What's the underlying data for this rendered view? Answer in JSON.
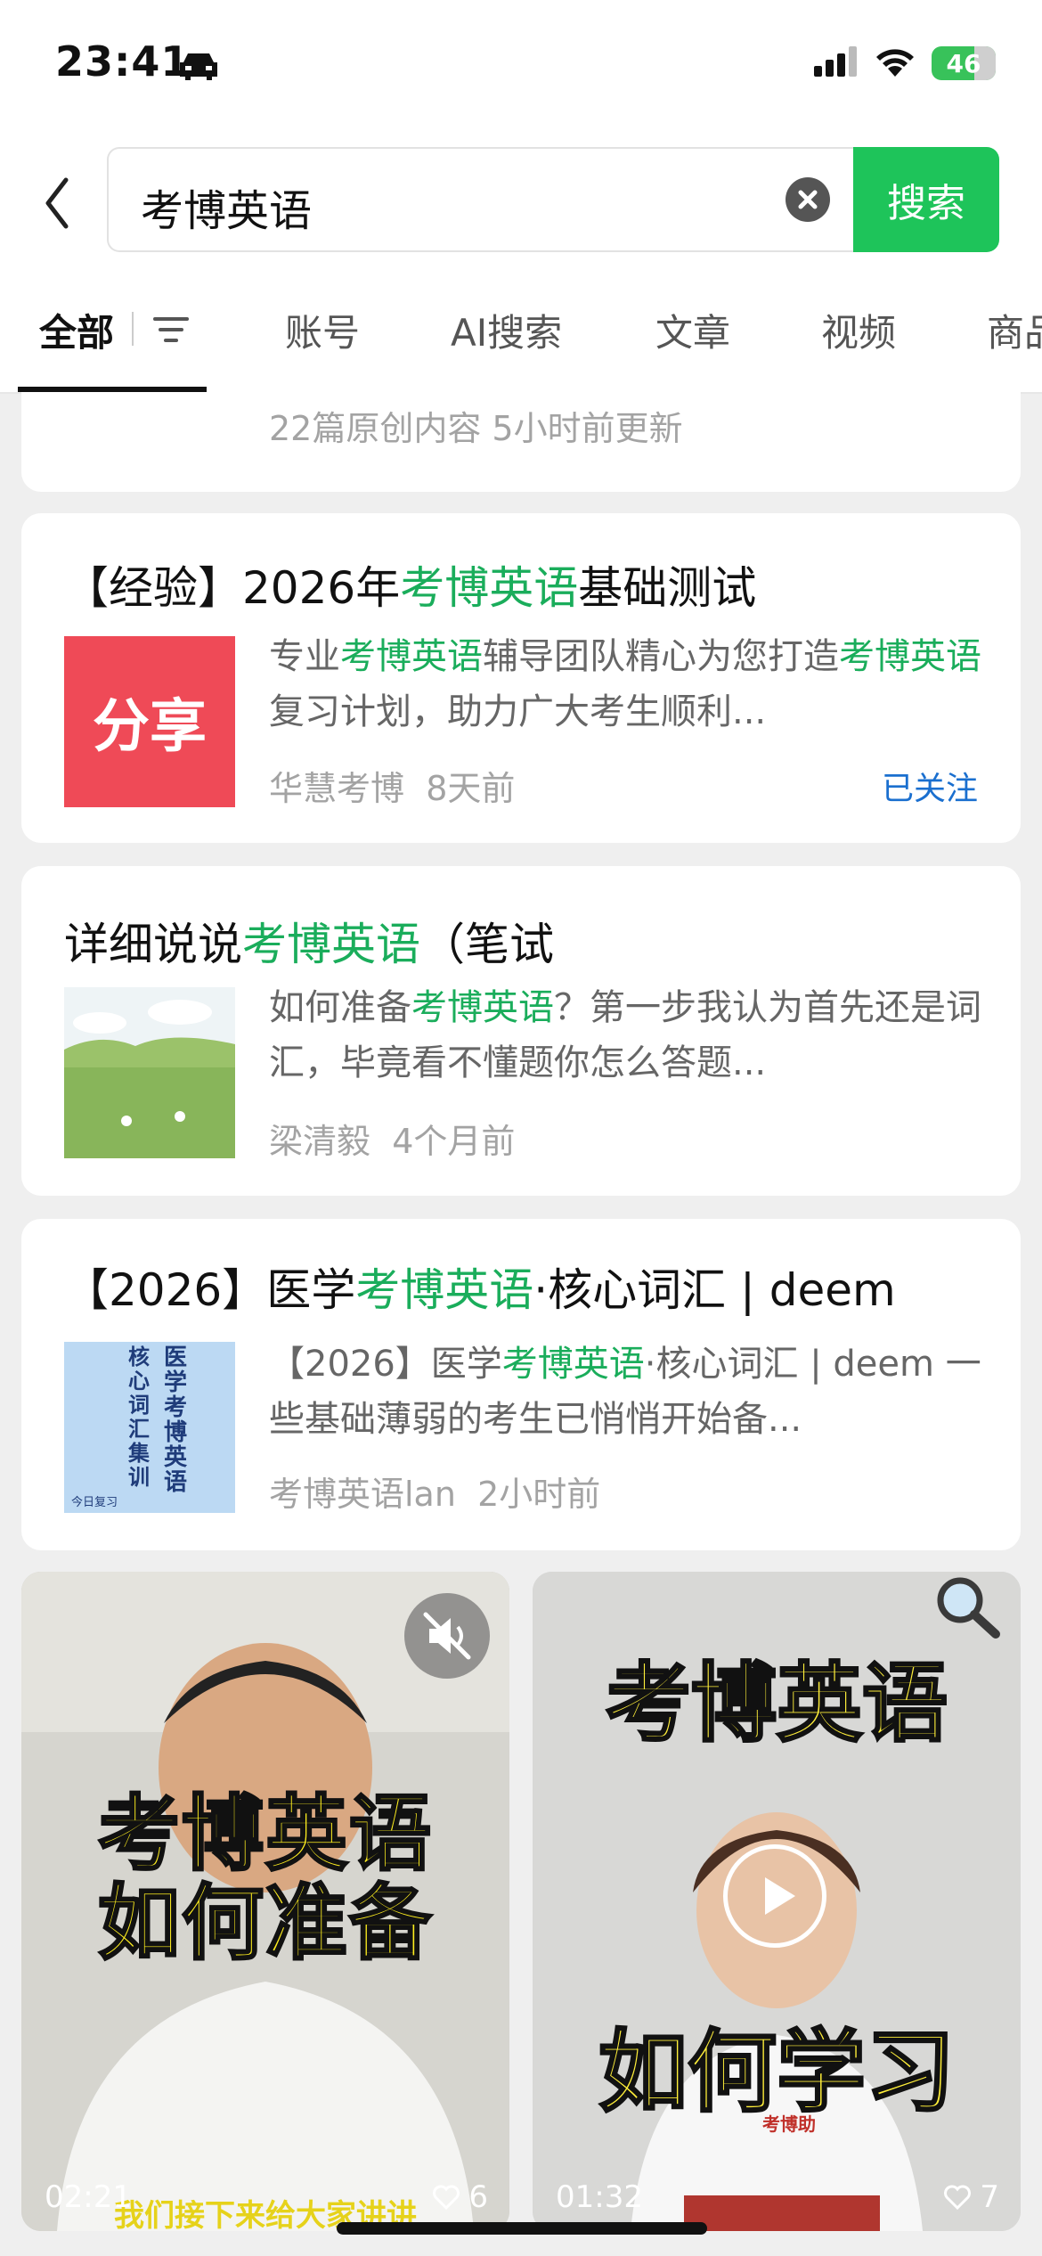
{
  "status_bar": {
    "time": "23:41",
    "battery": "46"
  },
  "search": {
    "query": "考博英语",
    "button": "搜索"
  },
  "tabs": [
    "全部",
    "账号",
    "AI搜索",
    "文章",
    "视频",
    "商品"
  ],
  "cards": [
    {
      "meta": "22篇原创内容  5小时前更新"
    },
    {
      "title_a": "【经验】2026年",
      "title_hl": "考博英语",
      "title_b": "基础测试",
      "thumb_text": "分享",
      "snip_a": "专业",
      "snip_hl1": "考博英语",
      "snip_b": "辅导团队精心为您打造",
      "snip_hl2": "考博英语",
      "snip_c": "复习计划，助力广大考生顺利...",
      "author": "华慧考博",
      "time": "8天前",
      "follow": "已关注"
    },
    {
      "title_a": "详细说说",
      "title_hl": "考博英语",
      "title_b": "（笔试",
      "snip_a": "如何准备",
      "snip_hl1": "考博英语",
      "snip_b": "？第一步我认为首先还是词汇，毕竟看不懂题你怎么答题...",
      "author": "梁清毅",
      "time": "4个月前"
    },
    {
      "title_a": "【2026】医学",
      "title_hl": "考博英语",
      "title_b": "·核心词汇 | deem",
      "thumb_lines": [
        "医学考博英语",
        "核心词汇集训",
        "今日复习"
      ],
      "snip_a": "【2026】医学",
      "snip_hl1": "考博英语",
      "snip_b": "·核心词汇 | deem 一些基础薄弱的考生已悄悄开始备...",
      "author": "考博英语lan",
      "time": "2小时前"
    }
  ],
  "videos": [
    {
      "caption_1": "考博英语",
      "caption_2": "如何准备",
      "subtitle": "我们接下来给大家讲讲",
      "duration": "02:21",
      "likes": "6"
    },
    {
      "caption_1": "考博英语",
      "caption_2": "如何学习",
      "brand": "考博助",
      "duration": "01:32",
      "likes": "7"
    }
  ],
  "colors": {
    "highlight": "#1aad5b",
    "search_button": "#1ec45a",
    "follow": "#1a6fcf",
    "share_tile": "#ef4a57"
  }
}
